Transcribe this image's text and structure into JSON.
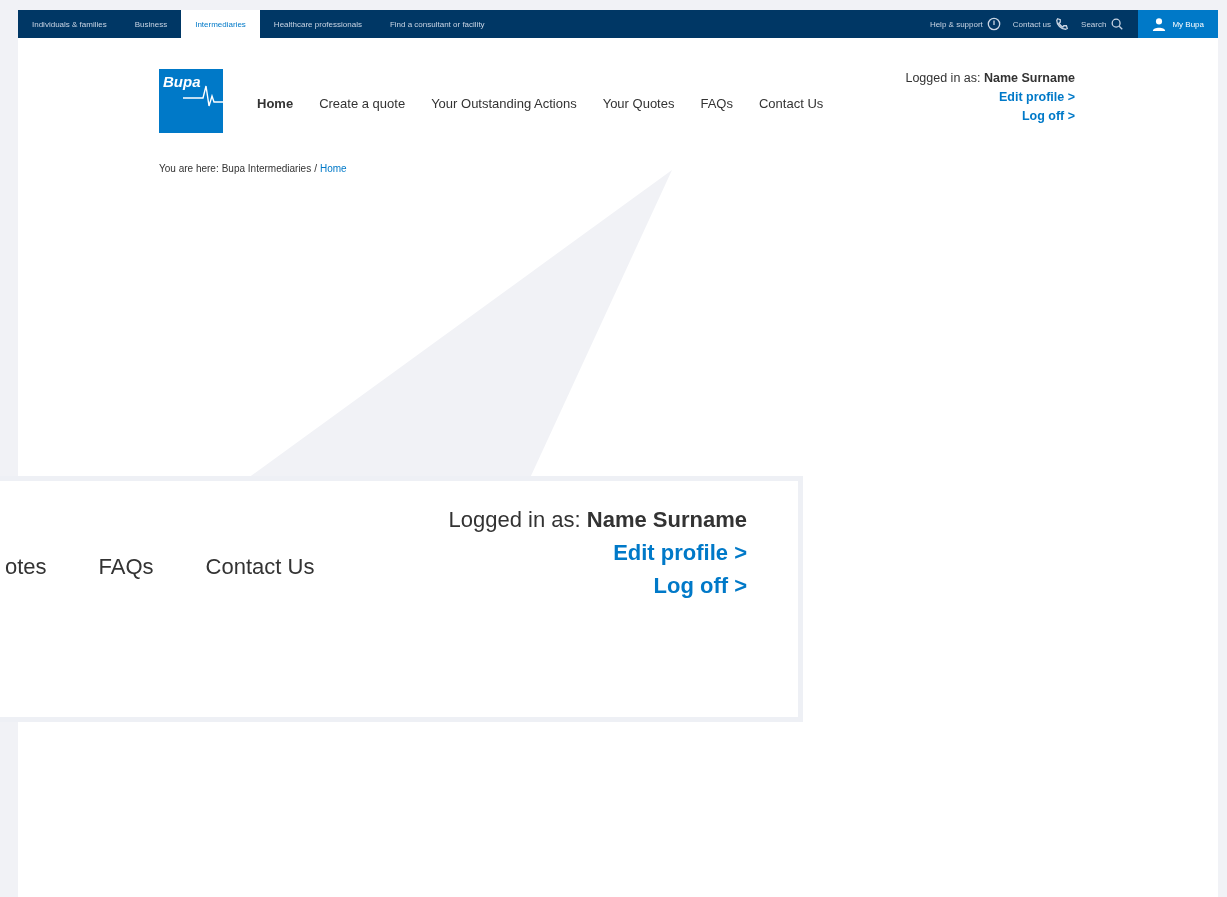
{
  "top_bar": {
    "tabs": [
      {
        "label": "Individuals & families",
        "selected": false
      },
      {
        "label": "Business",
        "selected": false
      },
      {
        "label": "Intermediaries",
        "selected": true
      },
      {
        "label": "Healthcare professionals",
        "selected": false
      },
      {
        "label": "Find a consultant or facility",
        "selected": false
      }
    ],
    "utilities": [
      {
        "label": "Help & support",
        "kind": "help"
      },
      {
        "label": "Contact us",
        "kind": "phone"
      },
      {
        "label": "Search",
        "kind": "search"
      }
    ],
    "account": {
      "label": "My Bupa"
    }
  },
  "header": {
    "logo": {
      "text": "Bupa"
    },
    "nav": [
      {
        "label": "Home",
        "selected": true
      },
      {
        "label": "Create a quote",
        "selected": false
      },
      {
        "label": "Your Outstanding Actions",
        "selected": false
      },
      {
        "label": "Your Quotes",
        "selected": false
      },
      {
        "label": "FAQs",
        "selected": false
      },
      {
        "label": "Contact Us",
        "selected": false
      }
    ],
    "user": "Logged in as: **Name Surname**",
    "links": [
      "Edit profile >",
      "Log off >"
    ]
  },
  "breadcrumb": {
    "prefix": "You are here:",
    "items": [
      {
        "label": "Bupa Intermediaries",
        "current": false
      },
      {
        "label": "Home",
        "current": true
      }
    ],
    "separator": "/"
  },
  "callout": {
    "nav": [
      "otes",
      "FAQs",
      "Contact Us"
    ],
    "user": "Logged in as: **Name Surname**",
    "links": [
      "Edit profile >",
      "Log off >"
    ]
  }
}
